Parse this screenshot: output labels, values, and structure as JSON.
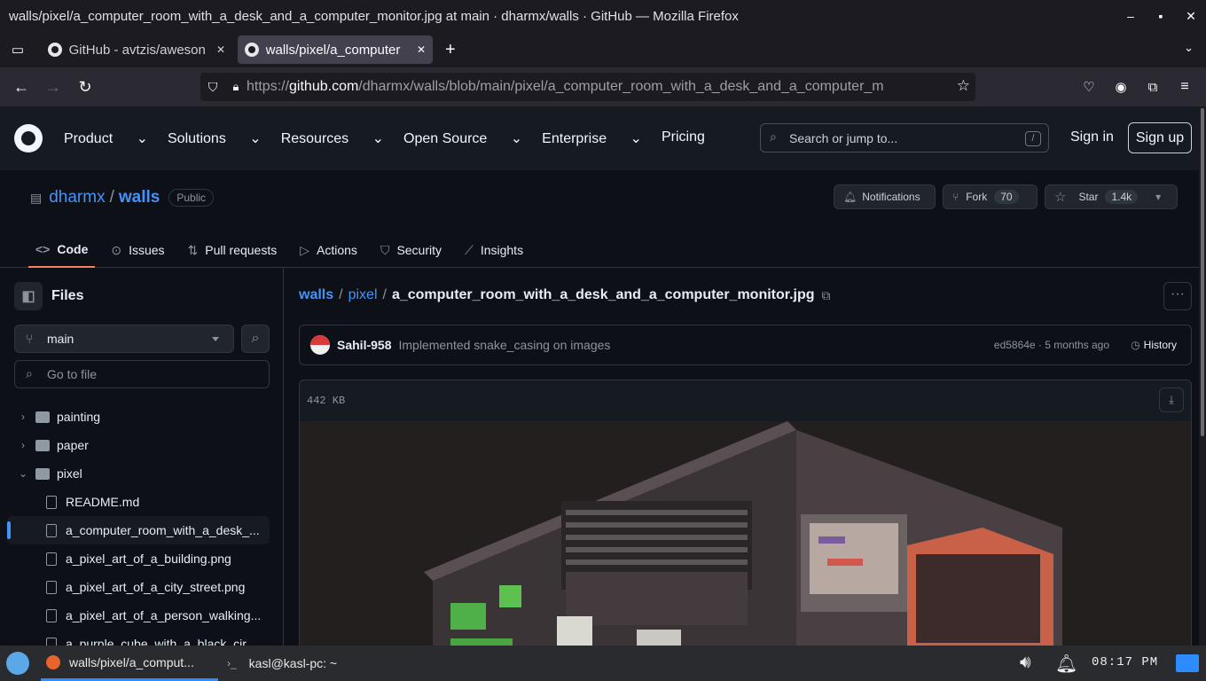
{
  "window": {
    "title": "walls/pixel/a_computer_room_with_a_desk_and_a_computer_monitor.jpg at main · dharmx/walls · GitHub — Mozilla Firefox"
  },
  "tabs": [
    {
      "label": "GitHub - avtzis/aweson"
    },
    {
      "label": "walls/pixel/a_computer"
    }
  ],
  "url": {
    "prefix": "https://",
    "host": "github.com",
    "path": "/dharmx/walls/blob/main/pixel/a_computer_room_with_a_desk_and_a_computer_m"
  },
  "header": {
    "nav": [
      "Product",
      "Solutions",
      "Resources",
      "Open Source",
      "Enterprise",
      "Pricing"
    ],
    "search_placeholder": "Search or jump to...",
    "search_key": "/",
    "signin": "Sign in",
    "signup": "Sign up"
  },
  "repo": {
    "owner": "dharmx",
    "name": "walls",
    "visibility": "Public",
    "notifications": "Notifications",
    "fork": "Fork",
    "fork_count": "70",
    "star": "Star",
    "star_count": "1.4k",
    "tabs": [
      "Code",
      "Issues",
      "Pull requests",
      "Actions",
      "Security",
      "Insights"
    ]
  },
  "sidebar": {
    "title": "Files",
    "branch": "main",
    "goto": "Go to file",
    "tree": [
      {
        "label": "painting",
        "type": "folder",
        "open": false
      },
      {
        "label": "paper",
        "type": "folder",
        "open": false
      },
      {
        "label": "pixel",
        "type": "folder",
        "open": true
      },
      {
        "label": "README.md",
        "type": "file"
      },
      {
        "label": "a_computer_room_with_a_desk_...",
        "type": "file",
        "current": true
      },
      {
        "label": "a_pixel_art_of_a_building.png",
        "type": "file"
      },
      {
        "label": "a_pixel_art_of_a_city_street.png",
        "type": "file"
      },
      {
        "label": "a_pixel_art_of_a_person_walking...",
        "type": "file"
      },
      {
        "label": "a_purple_cube_with_a_black_cir...",
        "type": "file"
      }
    ]
  },
  "breadcrumb": {
    "root": "walls",
    "folder": "pixel",
    "file": "a_computer_room_with_a_desk_and_a_computer_monitor.jpg"
  },
  "commit": {
    "author": "Sahil-958",
    "message": "Implemented snake_casing on images",
    "hash_time": "ed5864e · 5 months ago",
    "history": "History"
  },
  "file": {
    "size": "442 KB"
  },
  "taskbar": {
    "items": [
      "walls/pixel/a_comput...",
      "kasl@kasl-pc: ~"
    ],
    "clock": "08:17 PM"
  }
}
